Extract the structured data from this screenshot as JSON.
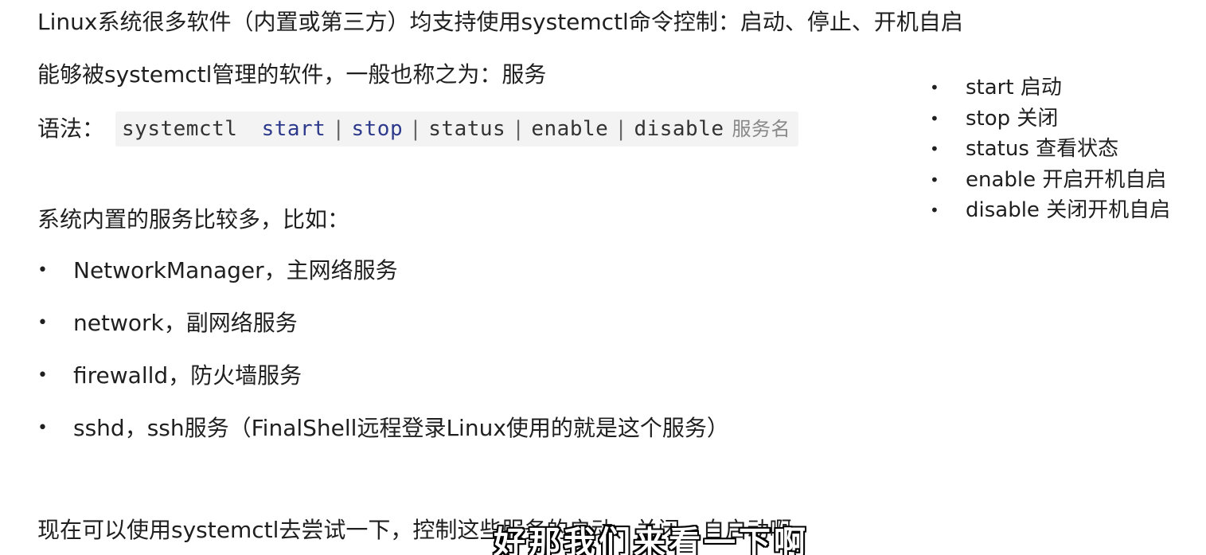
{
  "lines": {
    "intro": "Linux系统很多软件（内置或第三方）均支持使用systemctl命令控制：启动、停止、开机自启",
    "service_def": "能够被systemctl管理的软件，一般也称之为：服务",
    "builtin": "系统内置的服务比较多，比如：",
    "bottom": "现在可以使用systemctl去尝试一下，控制这些服务的启动、关闭、自启动啊"
  },
  "syntax": {
    "label": "语法：",
    "command": "systemctl",
    "options": [
      "start",
      "stop",
      "status",
      "enable",
      "disable"
    ],
    "separator": "|",
    "service_name": "服务名"
  },
  "services": [
    "NetworkManager，主网络服务",
    "network，副网络服务",
    "firewalld，防火墙服务",
    "sshd，ssh服务（FinalShell远程登录Linux使用的就是这个服务）"
  ],
  "side_notes": [
    "start 启动",
    "stop 关闭",
    "status 查看状态",
    "enable 开启开机自启",
    "disable 关闭开机自启"
  ],
  "bullet_glyph": "•",
  "subtitle": "好那我们来看一下啊"
}
